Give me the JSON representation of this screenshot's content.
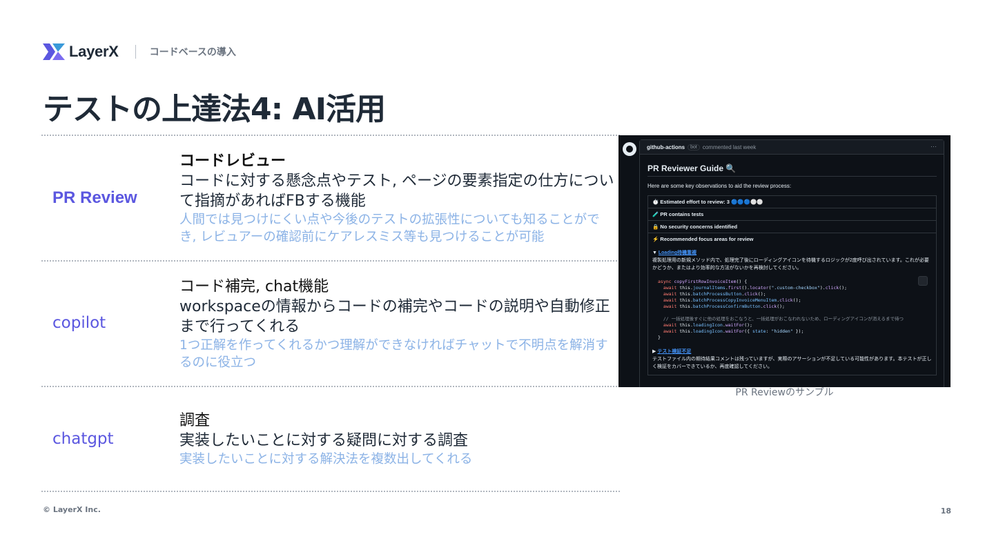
{
  "header": {
    "logo_text": "LayerX",
    "section": "コードベースの導入"
  },
  "title": "テストの上達法4: AI活用",
  "rows": [
    {
      "label": "PR Review",
      "heading": "コードレビュー",
      "text": "コードに対する懸念点やテスト, ページの要素指定の仕方について指摘があればFBする機能",
      "note": "人間では見つけにくい点や今後のテストの拡張性についても知ることができ, レビュアーの確認前にケアレスミス等も見つけることが可能"
    },
    {
      "label": "copilot",
      "heading": "コード補完, chat機能",
      "text": "workspaceの情報からコードの補完やコードの説明や自動修正まで行ってくれる",
      "note": "1つ正解を作ってくれるかつ理解ができなければチャットで不明点を解消するのに役立つ"
    },
    {
      "label": "chatgpt",
      "heading": "調査",
      "text": "実装したいことに対する疑問に対する調査",
      "note": "実装したいことに対する解決法を複数出してくれる"
    }
  ],
  "screenshot": {
    "user": "github-actions",
    "bot_badge": "bot",
    "action": "commented last week",
    "menu": "···",
    "guide_title": "PR Reviewer Guide 🔍",
    "intro": "Here are some key observations to aid the review process:",
    "items": [
      "⏱️ Estimated effort to review: 3 🔵🔵🔵⚪⚪",
      "🧪 PR contains tests",
      "🔒 No security concerns identified",
      "⚡ Recommended focus areas for review"
    ],
    "focus1_title": "Loading待機重複",
    "focus1_text": "複製処理用の新規メソッド内で、処理完了後にローディングアイコンを待機するロジックが2度呼び出されています。これが必要かどうか、またはより効率的な方法がないかを再検討してください。",
    "focus2_title": "テスト検証不足",
    "focus2_text": "テストファイル内の期待結果コメントは残っていますが、実際のアサーションが不足している可能性があります。本テストが正しく検証をカバーできているか、再度確認してください。"
  },
  "caption": "PR Reviewのサンプル",
  "footer": {
    "copyright": "© LayerX Inc.",
    "page": "18"
  },
  "colors": {
    "label": "#5b57e0",
    "note": "#8cb3e6",
    "title": "#1f2a37"
  }
}
